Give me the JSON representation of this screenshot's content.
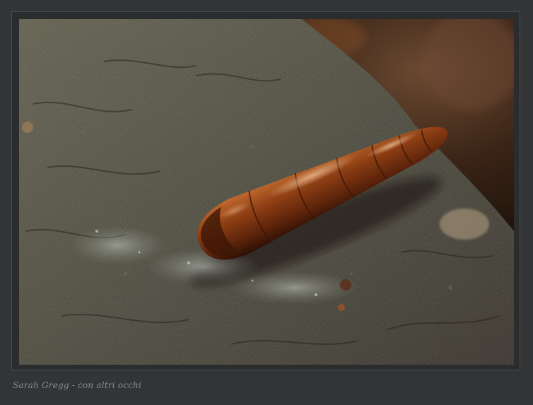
{
  "caption": {
    "text": "Sarah Gregg - con altri occhi"
  },
  "colors": {
    "page_background": "#333435",
    "frame_border": "#4a4c4e",
    "caption_text": "#8a8c8e",
    "shell_brown": "#7a3410",
    "bark_green_grey": "#4a4a38"
  }
}
